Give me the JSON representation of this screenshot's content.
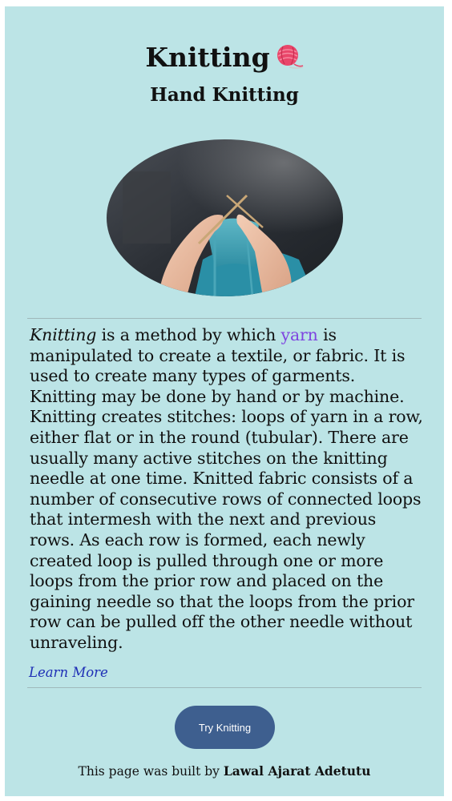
{
  "header": {
    "title": "Knitting",
    "title_icon": "yarn-ball-icon",
    "subtitle": "Hand Knitting"
  },
  "hero_image": {
    "subject": "hands-knitting-photo"
  },
  "article": {
    "lead_italic": "Knitting",
    "text_1": " is a method by which ",
    "yarn_link": "yarn",
    "text_2": " is manipulated to create a textile, or fabric. It is used to create many types of garments. Knitting may be done by hand or by machine. Knitting creates stitches: loops of yarn in a row, either flat or in the round (tubular). There are usually many active stitches on the knitting needle at one time. Knitted fabric consists of a number of consecutive rows of connected loops that intermesh with the next and previous rows. As each row is formed, each newly created loop is pulled through one or more loops from the prior row and placed on the gaining needle so that the loops from the prior row can be pulled off the other needle without unraveling."
  },
  "links": {
    "learn_more": "Learn More"
  },
  "cta": {
    "label": "Try Knitting"
  },
  "footer": {
    "prefix": "This page was built by ",
    "author": "Lawal Ajarat Adetutu"
  },
  "colors": {
    "background": "#bce4e6",
    "button": "#3e5f8f",
    "link": "#1f2fb6",
    "visited_link": "#7f45e0"
  }
}
